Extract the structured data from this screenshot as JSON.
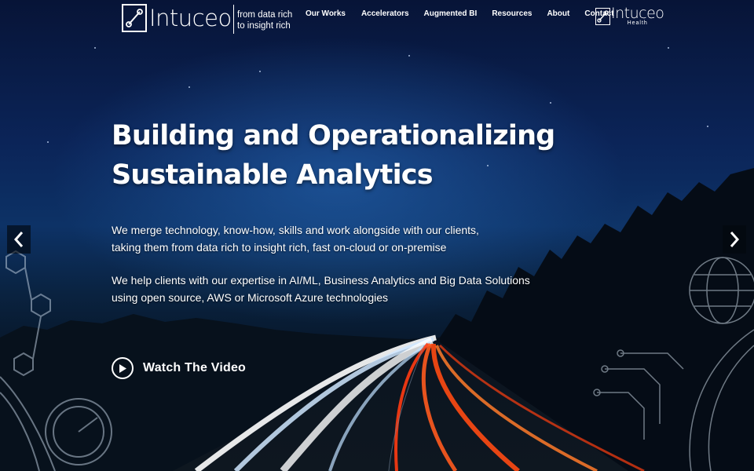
{
  "brand": {
    "name": "Intuceo",
    "tagline_line1": "from data rich",
    "tagline_line2": "to insight rich"
  },
  "nav": {
    "items": [
      {
        "label": "Our Works"
      },
      {
        "label": "Accelerators"
      },
      {
        "label": "Augmented BI"
      },
      {
        "label": "Resources"
      },
      {
        "label": "About"
      },
      {
        "label": "Contact"
      }
    ]
  },
  "health_logo": {
    "name": "Intuceo",
    "sub": "Health"
  },
  "hero": {
    "headline_line1": "Building and Operationalizing",
    "headline_line2": "Sustainable Analytics",
    "para1_line1": "We merge technology, know-how, skills and work alongside with our clients,",
    "para1_line2": "taking them from data rich to insight rich, fast on-cloud or on-premise",
    "para2_line1": "We help clients with our expertise in AI/ML, Business Analytics and Big Data Solutions",
    "para2_line2": "using open source, AWS or Microsoft Azure technologies",
    "watch_label": "Watch The Video"
  },
  "icons": {
    "prev": "chevron-left-icon",
    "next": "chevron-right-icon",
    "play": "play-circle-icon"
  },
  "colors": {
    "sky_top": "#071437",
    "sky_mid": "#0d3266",
    "light_trail_red": "#ff4a1c",
    "light_trail_white": "#eaf4ff"
  }
}
